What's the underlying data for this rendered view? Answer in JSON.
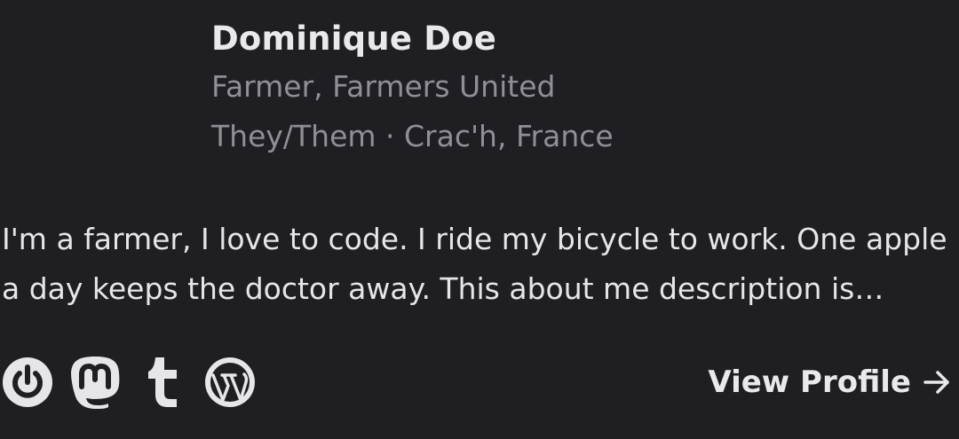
{
  "profile": {
    "name": "Dominique Doe",
    "role": "Farmer, Farmers United",
    "pronouns_location": "They/Them · Crac'h, France",
    "about": "I'm a farmer, I love to code. I ride my bicycle to work. One apple a day keeps the doctor away. This about me description is truncated after two lines."
  },
  "socials": [
    {
      "icon": "power-icon"
    },
    {
      "icon": "mastodon-icon"
    },
    {
      "icon": "tumblr-icon"
    },
    {
      "icon": "wordpress-icon"
    }
  ],
  "actions": {
    "view_profile_label": "View Profile",
    "view_profile_icon": "arrow-right-icon"
  },
  "colors": {
    "background": "#1f1e22",
    "primary_text": "#e9e9ec",
    "secondary_text": "#8f8f95"
  }
}
